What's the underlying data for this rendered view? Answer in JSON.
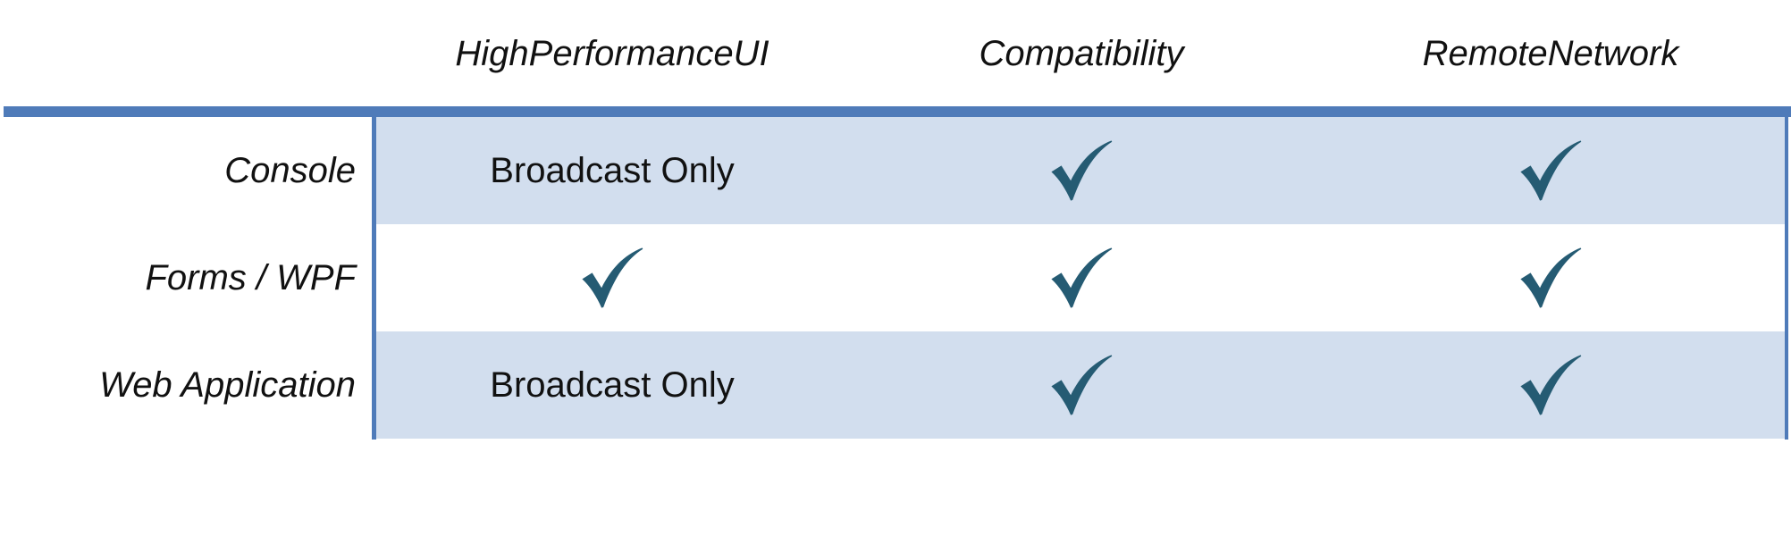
{
  "table": {
    "columns": [
      "HighPerformanceUI",
      "Compatibility",
      "RemoteNetwork"
    ],
    "rows": [
      {
        "label": "Console",
        "cells": [
          {
            "type": "text",
            "text": "Broadcast Only"
          },
          {
            "type": "check",
            "icon": "checkmark-icon"
          },
          {
            "type": "check",
            "icon": "checkmark-icon"
          }
        ]
      },
      {
        "label": "Forms  / WPF",
        "cells": [
          {
            "type": "check",
            "icon": "checkmark-icon"
          },
          {
            "type": "check",
            "icon": "checkmark-icon"
          },
          {
            "type": "check",
            "icon": "checkmark-icon"
          }
        ]
      },
      {
        "label": "Web Application",
        "cells": [
          {
            "type": "text",
            "text": "Broadcast Only"
          },
          {
            "type": "check",
            "icon": "checkmark-icon"
          },
          {
            "type": "check",
            "icon": "checkmark-icon"
          }
        ]
      }
    ],
    "colors": {
      "rule": "#4f7bb9",
      "band": "#d2deee",
      "check": "#255b73"
    }
  }
}
